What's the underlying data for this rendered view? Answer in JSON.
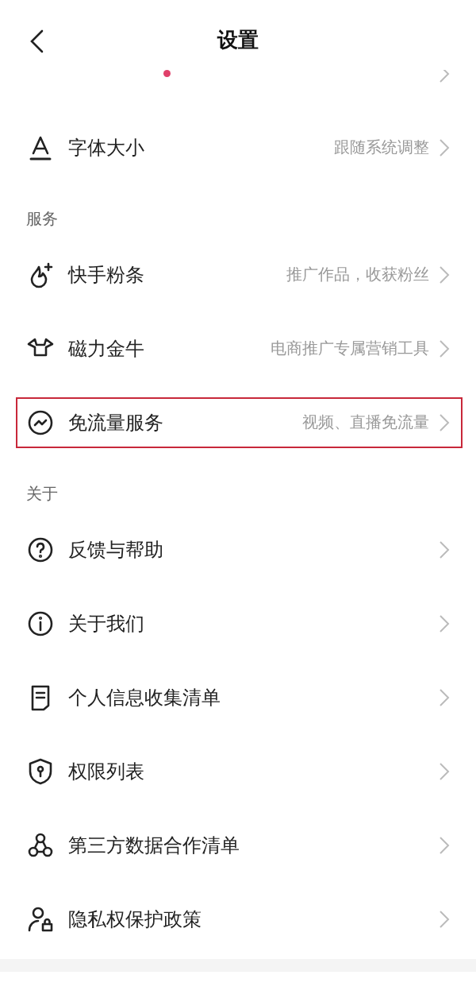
{
  "header": {
    "title": "设置"
  },
  "sections": [
    {
      "items": [
        {
          "badge_dot": true
        },
        {
          "label": "字体大小",
          "value": "跟随系统调整",
          "badge_dot": false,
          "highlighted": false
        }
      ]
    },
    {
      "title": "服务",
      "items": [
        {
          "label": "快手粉条",
          "value": "推广作品，收获粉丝",
          "badge_dot": false,
          "highlighted": false
        },
        {
          "label": "磁力金牛",
          "value": "电商推广专属营销工具",
          "badge_dot": false,
          "highlighted": false
        },
        {
          "label": "免流量服务",
          "value": "视频、直播免流量",
          "badge_dot": false,
          "highlighted": true
        }
      ]
    },
    {
      "title": "关于",
      "items": [
        {
          "label": "反馈与帮助",
          "badge_dot": false,
          "highlighted": false
        },
        {
          "label": "关于我们",
          "badge_dot": false,
          "highlighted": false
        },
        {
          "label": "个人信息收集清单",
          "badge_dot": false,
          "highlighted": false
        },
        {
          "label": "权限列表",
          "badge_dot": false,
          "highlighted": false
        },
        {
          "label": "第三方数据合作清单",
          "badge_dot": false,
          "highlighted": false
        },
        {
          "label": "隐私权保护政策",
          "badge_dot": false,
          "highlighted": false
        }
      ]
    }
  ]
}
